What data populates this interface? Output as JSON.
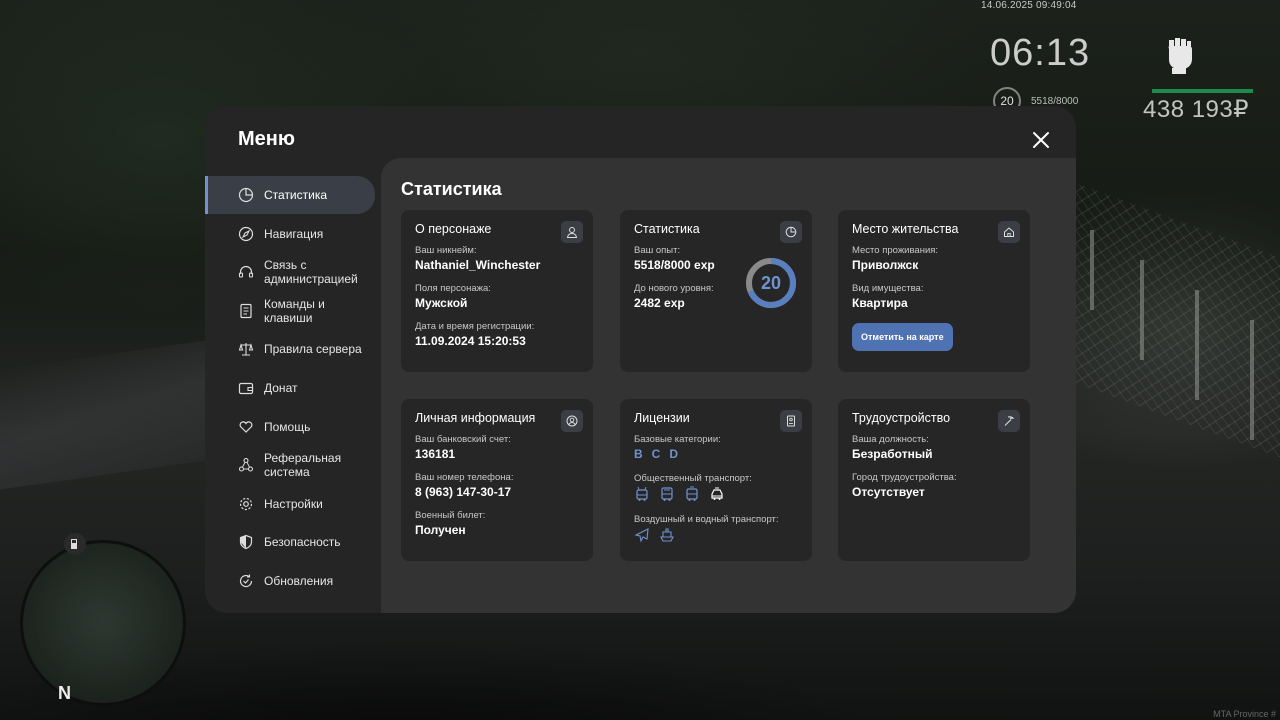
{
  "hud": {
    "datetime": "14.06.2025 09:49:04",
    "clock": "06:13",
    "level": "20",
    "exp": "5518/8000",
    "money": "438 193₽",
    "compass_n": "N",
    "watermark": "MTA Province #"
  },
  "menu": {
    "title": "Меню",
    "sidebar": [
      {
        "label": "Статистика",
        "icon": "pie-chart-icon",
        "active": true
      },
      {
        "label": "Навигация",
        "icon": "compass-icon"
      },
      {
        "label": "Связь с администрацией",
        "icon": "headset-icon"
      },
      {
        "label": "Команды и клавиши",
        "icon": "document-icon"
      },
      {
        "label": "Правила сервера",
        "icon": "scales-icon"
      },
      {
        "label": "Донат",
        "icon": "wallet-icon"
      },
      {
        "label": "Помощь",
        "icon": "heart-hand-icon"
      },
      {
        "label": "Реферальная система",
        "icon": "network-icon"
      },
      {
        "label": "Настройки",
        "icon": "gear-icon"
      },
      {
        "label": "Безопасность",
        "icon": "shield-icon"
      },
      {
        "label": "Обновления",
        "icon": "refresh-check-icon"
      }
    ]
  },
  "content": {
    "title": "Статистика",
    "character": {
      "title": "О персонаже",
      "nickname_label": "Ваш никнейм:",
      "nickname": "Nathaniel_Winchester",
      "gender_label": "Поля персонажа:",
      "gender": "Мужской",
      "regdate_label": "Дата и время регистрации:",
      "regdate": "11.09.2024 15:20:53"
    },
    "stats": {
      "title": "Статистика",
      "exp_label": "Ваш опыт:",
      "exp": "5518/8000 exp",
      "next_label": "До нового уровня:",
      "next": "2482 exp",
      "level": "20",
      "progress": 0.69
    },
    "residence": {
      "title": "Место жительства",
      "place_label": "Место проживания:",
      "place": "Приволжск",
      "property_label": "Вид имущества:",
      "property": "Квартира",
      "button": "Отметить на карте"
    },
    "personal": {
      "title": "Личная информация",
      "bank_label": "Ваш банковский счет:",
      "bank": "136181",
      "phone_label": "Ваш номер телефона:",
      "phone": "8 (963) 147-30-17",
      "military_label": "Военный билет:",
      "military": "Получен"
    },
    "licenses": {
      "title": "Лицензии",
      "base_label": "Базовые категории:",
      "base": [
        "B",
        "C",
        "D"
      ],
      "public_label": "Общественный транспорт:",
      "air_label": "Воздушный и водный транспорт:"
    },
    "employment": {
      "title": "Трудоустройство",
      "position_label": "Ваша должность:",
      "position": "Безработный",
      "city_label": "Город трудоустройства:",
      "city": "Отсутствует"
    }
  },
  "colors": {
    "accent": "#6f93d1",
    "button": "#4e72b2",
    "panel": "#252525",
    "card": "#262626"
  }
}
